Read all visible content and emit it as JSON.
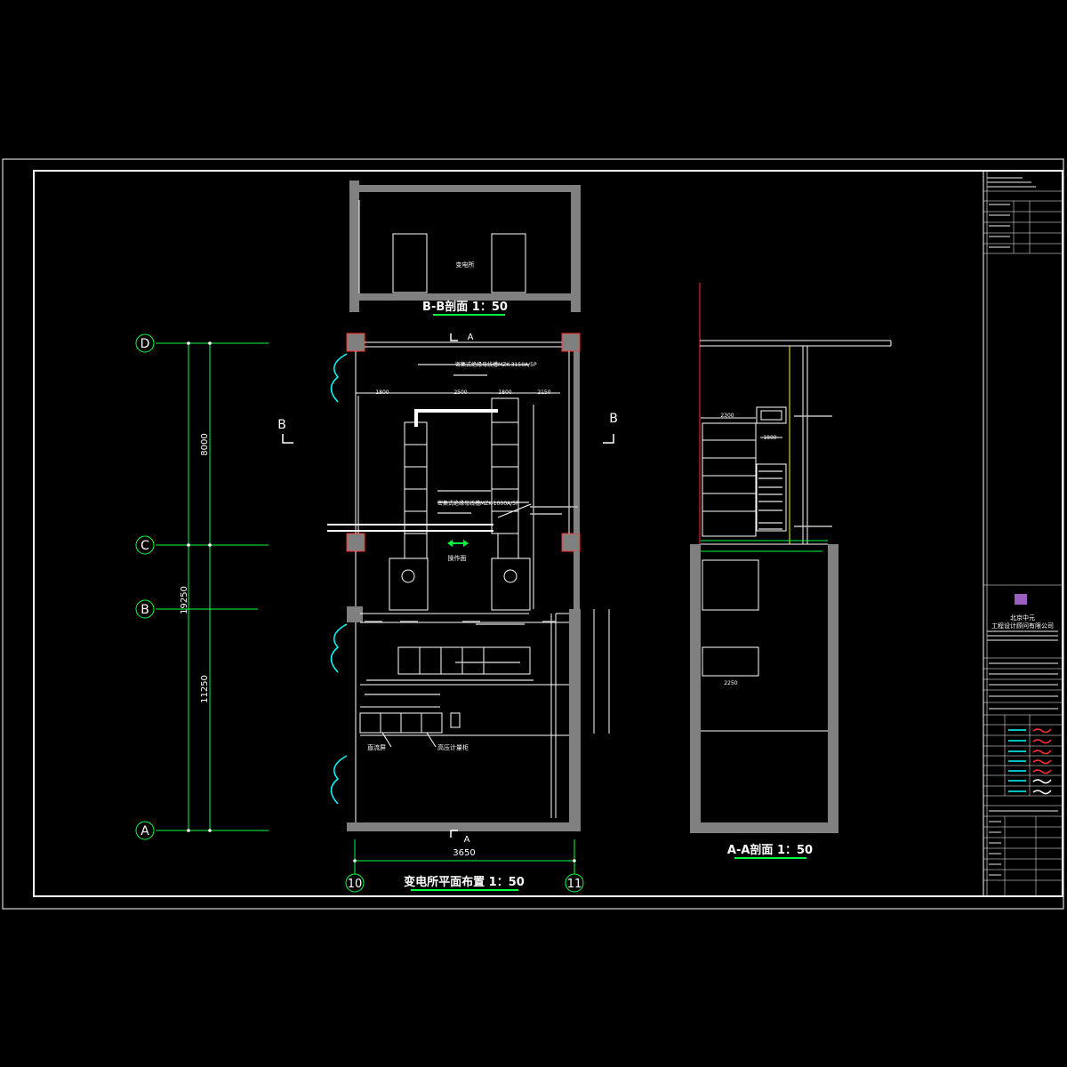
{
  "colors": {
    "background": "#000000",
    "frame": "#ffffff",
    "wall": "#808080",
    "axis": "#00ff40",
    "door": "#00ffff",
    "red_line": "#ff0000",
    "yellow_line": "#ffff00"
  },
  "grid_axes": {
    "rows": [
      "D",
      "C",
      "B",
      "A"
    ],
    "cols": [
      "10",
      "11"
    ]
  },
  "dimensions": {
    "total_vertical": "19250",
    "upper_vertical": "8000",
    "lower_vertical": "11250",
    "plan_width": "3650",
    "plan_top_1": "1800",
    "plan_top_2": "2500",
    "plan_top_3": "1800",
    "plan_top_4": "2150",
    "aa_dim_1": "2300",
    "aa_dim_2": "1800",
    "aa_dim_3": "2250"
  },
  "section_marks": {
    "a_top": "A",
    "a_bottom": "A",
    "b_left": "B",
    "b_right": "B"
  },
  "titles": {
    "plan": "变电所平面布置 1：50",
    "section_bb": "B-B剖面 1：50",
    "section_aa": "A-A剖面 1：50"
  },
  "labels": {
    "bb_room": "变电所",
    "operating_face": "操作面",
    "equip_1": "直流屏",
    "equip_2": "高压计量柜",
    "busbar_1": "密集式绝缘母线槽MZK-3150A/5P",
    "busbar_2": "密集式绝缘母线槽MZK-1000A/5P"
  },
  "title_block": {
    "company": "北京中元",
    "company_line2": "工程设计顾问有限公司"
  }
}
